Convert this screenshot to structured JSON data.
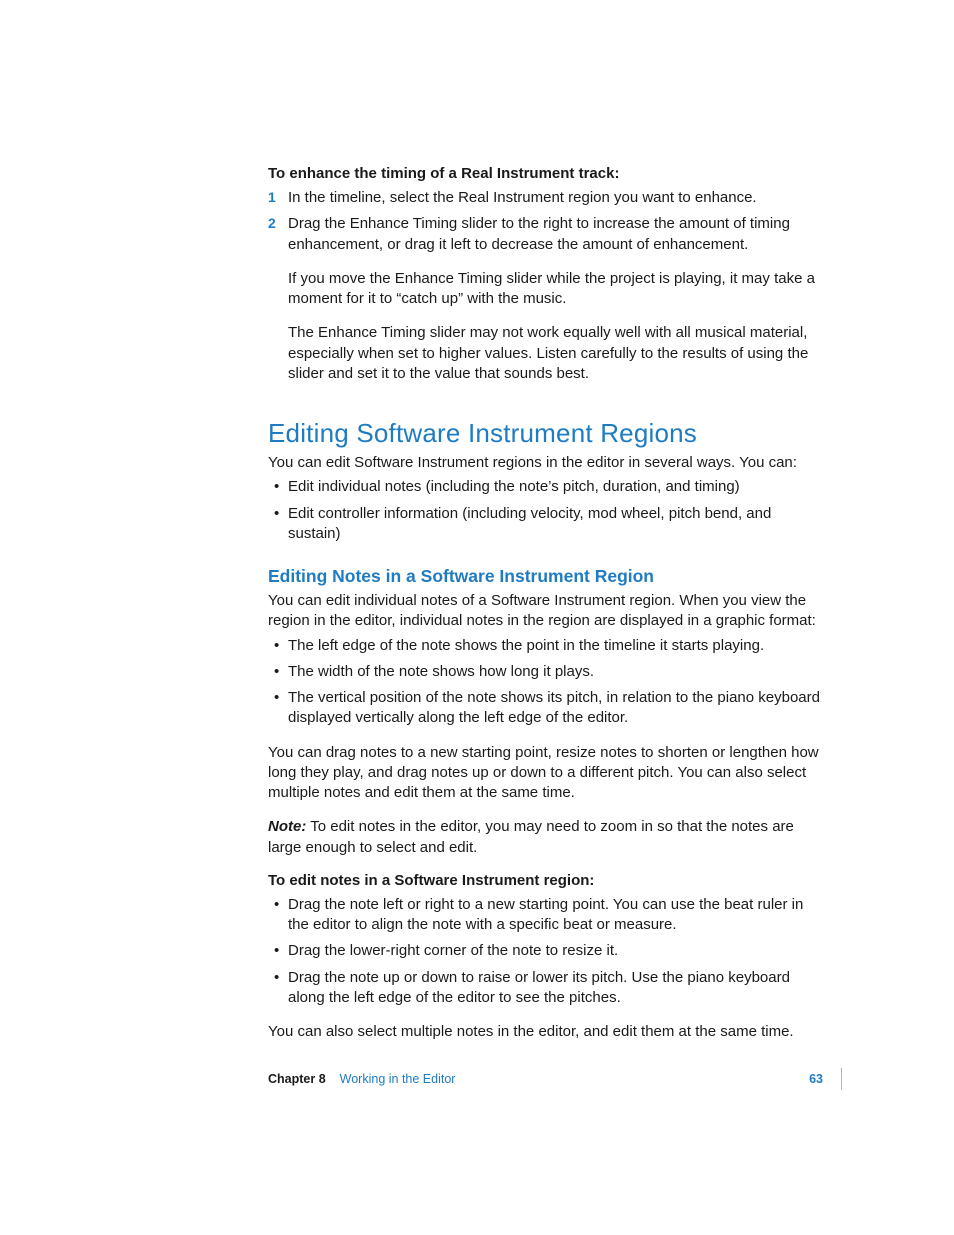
{
  "intro_heading": "To enhance the timing of a Real Instrument track:",
  "steps": [
    "In the timeline, select the Real Instrument region you want to enhance.",
    "Drag the Enhance Timing slider to the right to increase the amount of timing enhancement, or drag it left to decrease the amount of enhancement."
  ],
  "para_catchup": "If you move the Enhance Timing slider while the project is playing, it may take a moment for it to “catch up” with the music.",
  "para_material": "The Enhance Timing slider may not work equally well with all musical material, especially when set to higher values. Listen carefully to the results of using the slider and set it to the value that sounds best.",
  "h1": "Editing Software Instrument Regions",
  "h1_lead": "You can edit Software Instrument regions in the editor in several ways. You can:",
  "h1_bullets": [
    "Edit individual notes (including the note’s pitch, duration, and timing)",
    "Edit controller information (including velocity, mod wheel, pitch bend, and sustain)"
  ],
  "h2": "Editing Notes in a Software Instrument Region",
  "h2_lead": "You can edit individual notes of a Software Instrument region. When you view the region in the editor, individual notes in the region are displayed in a graphic format:",
  "h2_bullets": [
    "The left edge of the note shows the point in the timeline it starts playing.",
    "The width of the note shows how long it plays.",
    "The vertical position of the note shows its pitch, in relation to the piano keyboard displayed vertically along the left edge of the editor."
  ],
  "para_drag": "You can drag notes to a new starting point, resize notes to shorten or lengthen how long they play, and drag notes up or down to a different pitch. You can also select multiple notes and edit them at the same time.",
  "note_label": "Note:",
  "note_text": "To edit notes in the editor, you may need to zoom in so that the notes are large enough to select and edit.",
  "edit_heading": "To edit notes in a Software Instrument region:",
  "edit_bullets": [
    "Drag the note left or right to a new starting point. You can use the beat ruler in the editor to align the note with a specific beat or measure.",
    "Drag the lower-right corner of the note to resize it.",
    "Drag the note up or down to raise or lower its pitch. Use the piano keyboard along the left edge of the editor to see the pitches."
  ],
  "para_multi": "You can also select multiple notes in the editor, and edit them at the same time.",
  "footer": {
    "chapter_label": "Chapter 8",
    "chapter_title": "Working in the Editor",
    "page": "63"
  }
}
